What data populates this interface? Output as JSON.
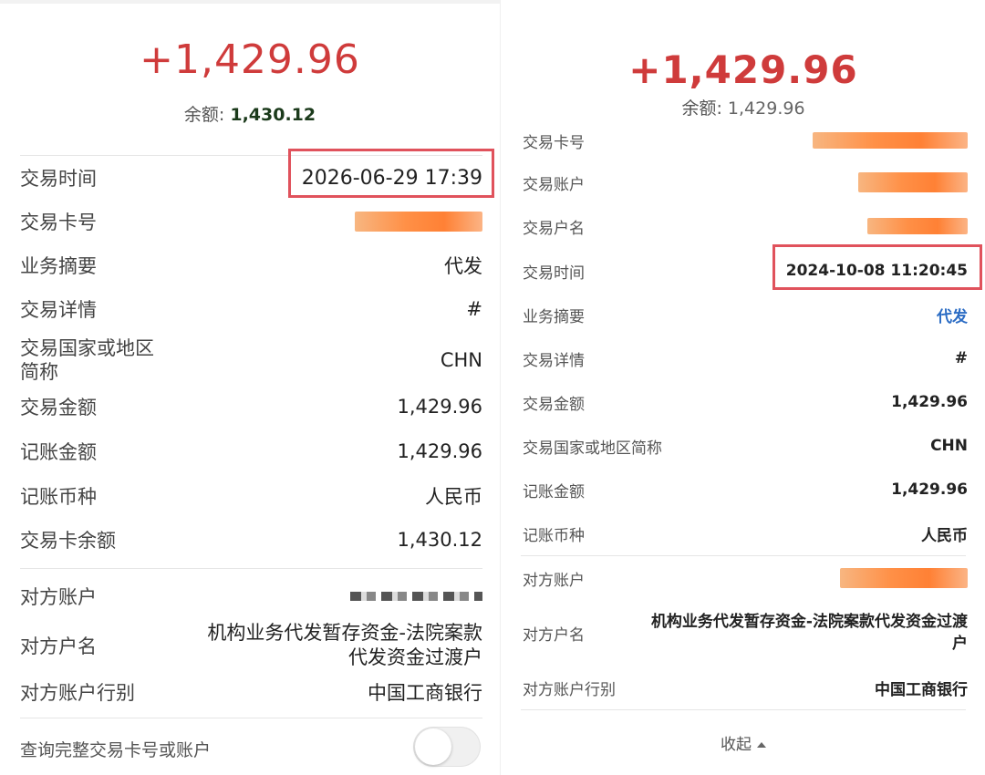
{
  "left": {
    "amount": "+1,429.96",
    "balance_label": "余额: ",
    "balance_value": "1,430.12",
    "rows": [
      {
        "label": "交易时间",
        "value": "2026-06-29 17:39"
      },
      {
        "label": "交易卡号",
        "value": ""
      },
      {
        "label": "业务摘要",
        "value": "代发"
      },
      {
        "label": "交易详情",
        "value": "#"
      },
      {
        "label": "交易国家或地区简称",
        "label_line1": "交易国家或地区",
        "label_line2": "简称",
        "value": "CHN"
      },
      {
        "label": "交易金额",
        "value": "1,429.96"
      },
      {
        "label": "记账金额",
        "value": "1,429.96"
      },
      {
        "label": "记账币种",
        "value": "人民币"
      },
      {
        "label": "交易卡余额",
        "value": "1,430.12"
      }
    ],
    "counterparty": [
      {
        "label": "对方账户",
        "value": ""
      },
      {
        "label": "对方户名",
        "value_line1": "机构业务代发暂存资金-法院案款",
        "value_line2": "代发资金过渡户"
      },
      {
        "label": "对方账户行别",
        "value": "中国工商银行"
      }
    ],
    "toggle_label": "查询完整交易卡号或账户",
    "toggle_on": false
  },
  "right": {
    "amount": "+1,429.96",
    "balance_label": "余额: ",
    "balance_value": "1,429.96",
    "rows": [
      {
        "label": "交易卡号",
        "value": ""
      },
      {
        "label": "交易账户",
        "value": ""
      },
      {
        "label": "交易户名",
        "value": ""
      },
      {
        "label": "交易时间",
        "value": "2024-10-08 11:20:45"
      },
      {
        "label": "业务摘要",
        "value": "代发"
      },
      {
        "label": "交易详情",
        "value": "#"
      },
      {
        "label": "交易金额",
        "value": "1,429.96"
      },
      {
        "label": "交易国家或地区简称",
        "value": "CHN"
      },
      {
        "label": "记账金额",
        "value": "1,429.96"
      },
      {
        "label": "记账币种",
        "value": "人民币"
      }
    ],
    "counterparty": [
      {
        "label": "对方账户",
        "value": ""
      },
      {
        "label": "对方户名",
        "value_line1": "机构业务代发暂存资金-法院案款代发资金过渡",
        "value_line2": "户"
      },
      {
        "label": "对方账户行别",
        "value": "中国工商银行"
      }
    ],
    "collapse_label": "收起"
  },
  "colors": {
    "amount_red": "#cf3b3b",
    "highlight_box": "#e0525c",
    "link_blue": "#2b6cc4",
    "redaction_orange": "#ff8a3d"
  }
}
